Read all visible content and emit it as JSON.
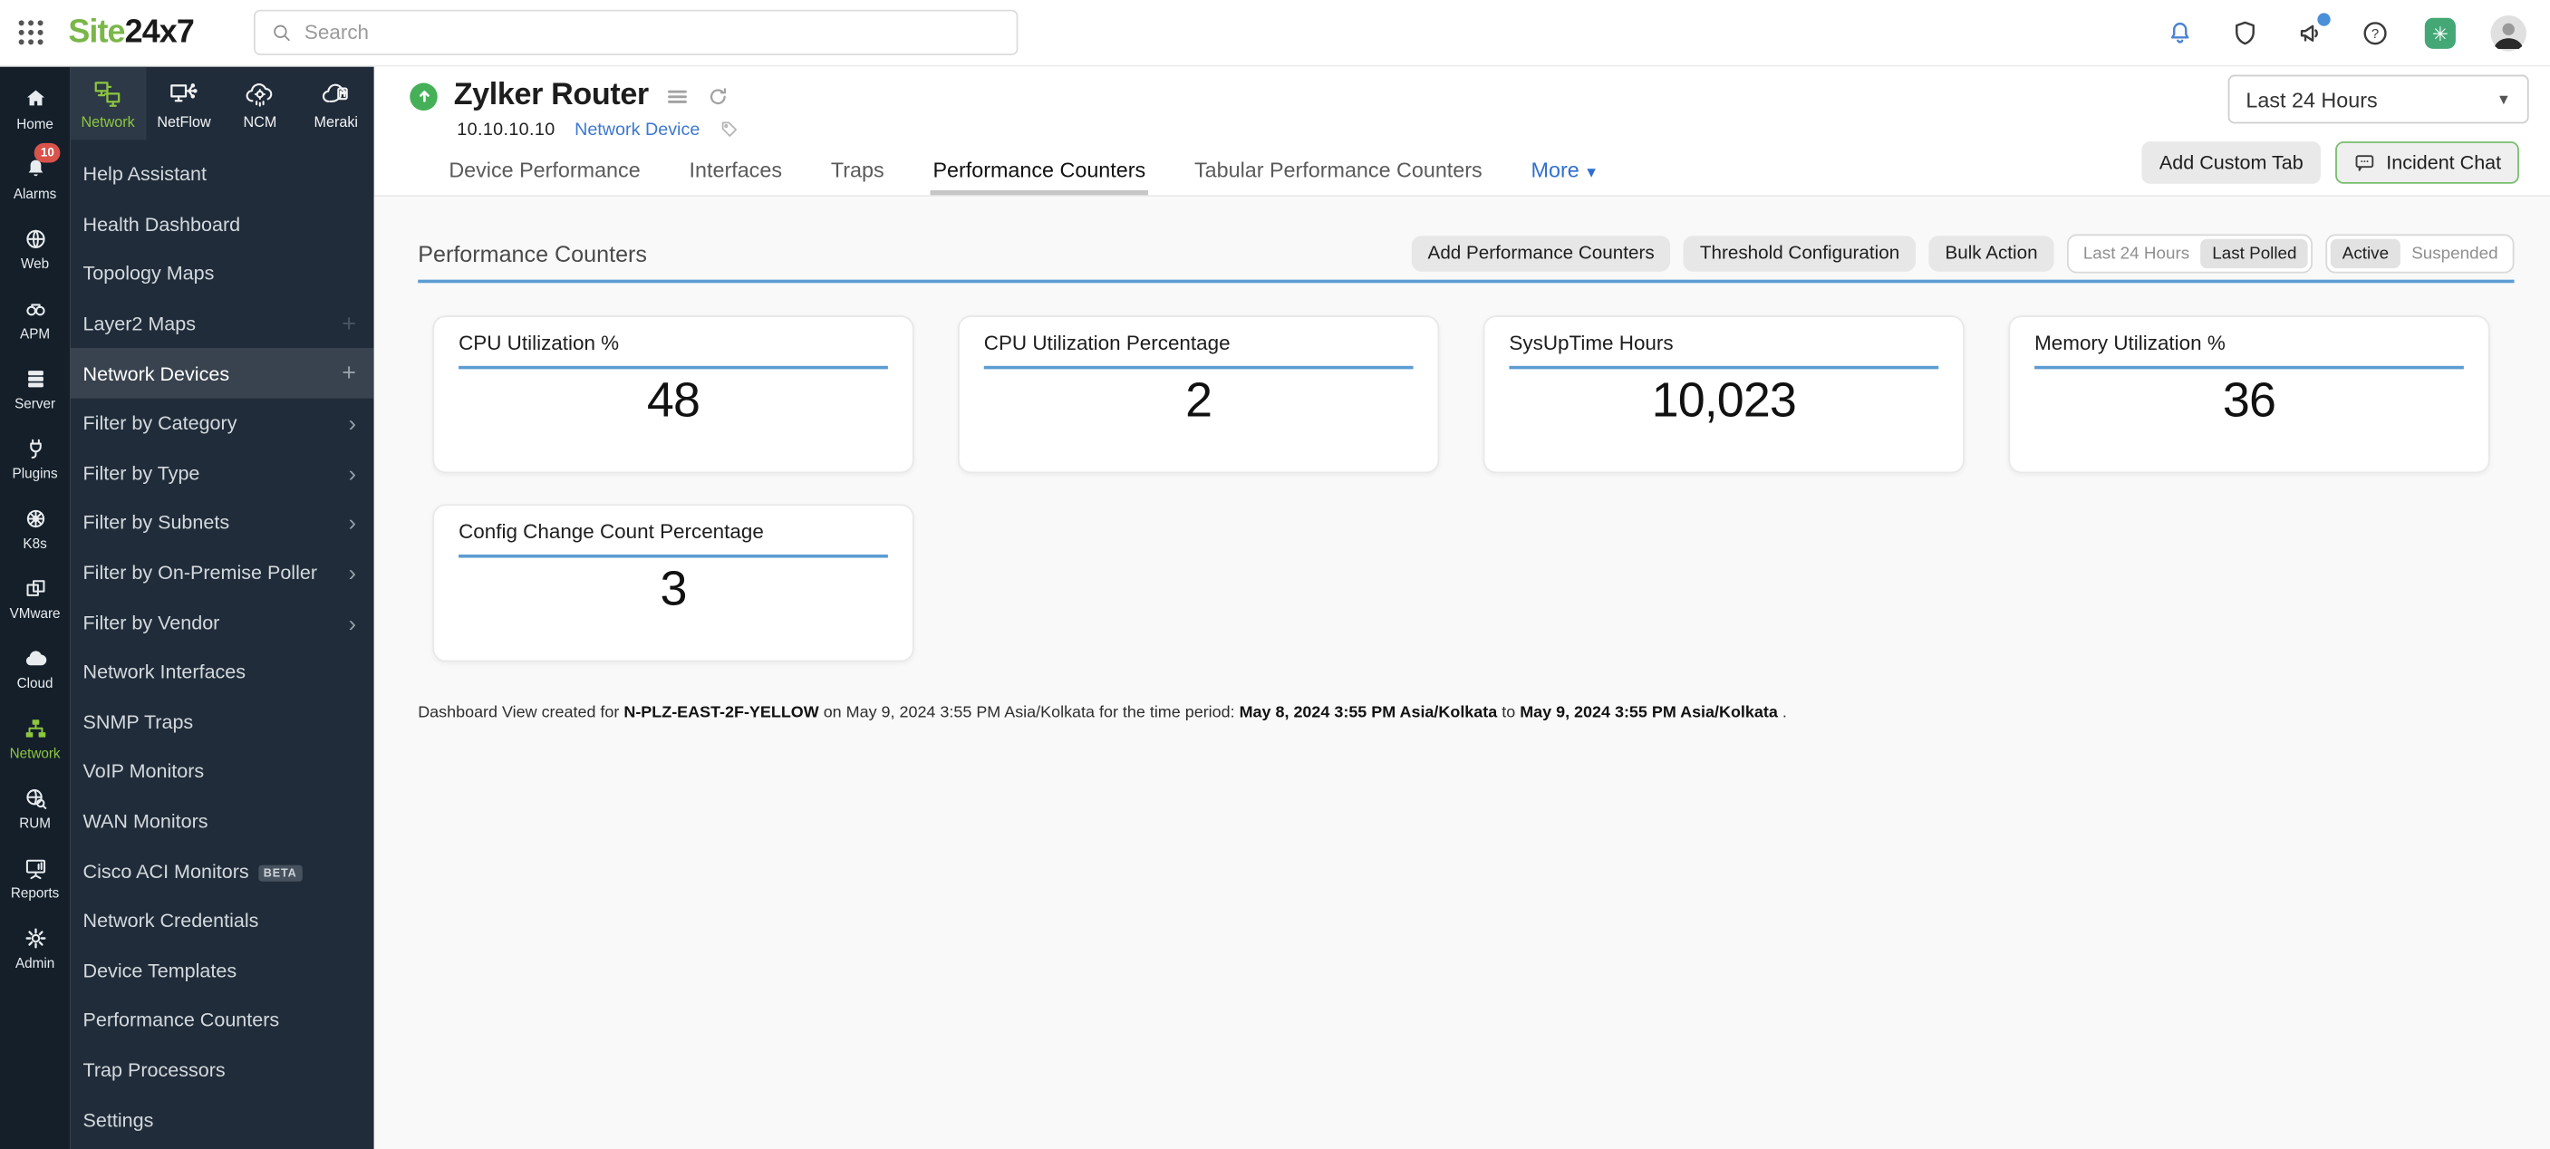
{
  "topbar": {
    "logo_part1": "Site",
    "logo_part2": "24x7",
    "search_placeholder": "Search",
    "icons": [
      {
        "icon": "bell-icon",
        "style": "blue"
      },
      {
        "icon": "shield-icon"
      },
      {
        "icon": "megaphone-icon",
        "badge_dot": true
      },
      {
        "icon": "help-icon"
      },
      {
        "icon": "ai-assistant-icon",
        "glyph": "✳"
      },
      {
        "icon": "avatar"
      }
    ]
  },
  "rail": {
    "items": [
      {
        "label": "Home",
        "icon": "home"
      },
      {
        "label": "Alarms",
        "icon": "bell",
        "badge": "10"
      },
      {
        "label": "Web",
        "icon": "globe"
      },
      {
        "label": "APM",
        "icon": "binoculars"
      },
      {
        "label": "Server",
        "icon": "server"
      },
      {
        "label": "Plugins",
        "icon": "plug"
      },
      {
        "label": "K8s",
        "icon": "helm"
      },
      {
        "label": "VMware",
        "icon": "vmware"
      },
      {
        "label": "Cloud",
        "icon": "cloud"
      },
      {
        "label": "Network",
        "icon": "network",
        "active": true
      },
      {
        "label": "RUM",
        "icon": "rum"
      },
      {
        "label": "Reports",
        "icon": "reports"
      },
      {
        "label": "Admin",
        "icon": "gear"
      }
    ]
  },
  "sidebar": {
    "tabs": [
      {
        "label": "Network",
        "icon": "network-monitors",
        "active": true
      },
      {
        "label": "NetFlow",
        "icon": "netflow"
      },
      {
        "label": "NCM",
        "icon": "ncm-cloud-gear"
      },
      {
        "label": "Meraki",
        "icon": "meraki-cloud"
      }
    ],
    "items": [
      {
        "label": "Help Assistant"
      },
      {
        "label": "Health Dashboard"
      },
      {
        "label": "Topology Maps"
      },
      {
        "label": "Layer2 Maps",
        "plus": "faint"
      },
      {
        "label": "Network Devices",
        "selected": true,
        "plus": "normal"
      },
      {
        "label": "Filter by Category",
        "chevron": true
      },
      {
        "label": "Filter by Type",
        "chevron": true
      },
      {
        "label": "Filter by Subnets",
        "chevron": true
      },
      {
        "label": "Filter by On-Premise Poller",
        "chevron": true
      },
      {
        "label": "Filter by Vendor",
        "chevron": true
      },
      {
        "label": "Network Interfaces"
      },
      {
        "label": "SNMP Traps"
      },
      {
        "label": "VoIP Monitors"
      },
      {
        "label": "WAN Monitors"
      },
      {
        "label": "Cisco ACI Monitors",
        "beta": "BETA"
      },
      {
        "label": "Network Credentials"
      },
      {
        "label": "Device Templates"
      },
      {
        "label": "Performance Counters"
      },
      {
        "label": "Trap Processors"
      },
      {
        "label": "Settings"
      }
    ]
  },
  "header": {
    "monitor_name": "Zylker Router",
    "status": "up",
    "ip": "10.10.10.10",
    "type_link": "Network Device",
    "time_range": "Last 24 Hours",
    "add_custom_tab": "Add Custom Tab",
    "incident_chat": "Incident Chat"
  },
  "tabs": [
    {
      "label": "Device Performance"
    },
    {
      "label": "Interfaces"
    },
    {
      "label": "Traps"
    },
    {
      "label": "Performance Counters",
      "active": true
    },
    {
      "label": "Tabular Performance Counters"
    },
    {
      "label": "More",
      "more": true
    }
  ],
  "section": {
    "title": "Performance Counters",
    "buttons": [
      "Add Performance Counters",
      "Threshold Configuration",
      "Bulk Action"
    ],
    "toggles": [
      {
        "options": [
          "Last 24 Hours",
          "Last Polled"
        ],
        "selected": 1
      },
      {
        "options": [
          "Active",
          "Suspended"
        ],
        "selected": 0
      }
    ]
  },
  "cards": [
    {
      "title": "CPU Utilization %",
      "value": "48"
    },
    {
      "title": "CPU Utilization Percentage",
      "value": "2"
    },
    {
      "title": "SysUpTime Hours",
      "value": "10,023"
    },
    {
      "title": "Memory Utilization %",
      "value": "36"
    },
    {
      "title": "Config Change Count Percentage",
      "value": "3"
    }
  ],
  "footer": {
    "segments": [
      {
        "text": "Dashboard View created for ",
        "bold": false
      },
      {
        "text": "N-PLZ-EAST-2F-YELLOW",
        "bold": true
      },
      {
        "text": " on May 9, 2024 3:55 PM Asia/Kolkata for the time period: ",
        "bold": false
      },
      {
        "text": "May 8, 2024 3:55 PM Asia/Kolkata",
        "bold": true
      },
      {
        "text": " to ",
        "bold": false
      },
      {
        "text": "May 9, 2024 3:55 PM Asia/Kolkata",
        "bold": true
      },
      {
        "text": " .",
        "bold": false
      }
    ]
  },
  "colors": {
    "brand_green": "#7ab648",
    "accent_green": "#8dc63f",
    "status_up_green": "#45b058",
    "link_blue": "#3c78cf",
    "underline_blue": "#5d9cd3",
    "alarm_badge_red": "#d9534a",
    "rail_bg": "#141f2a",
    "sidebar_bg": "#202c39"
  }
}
